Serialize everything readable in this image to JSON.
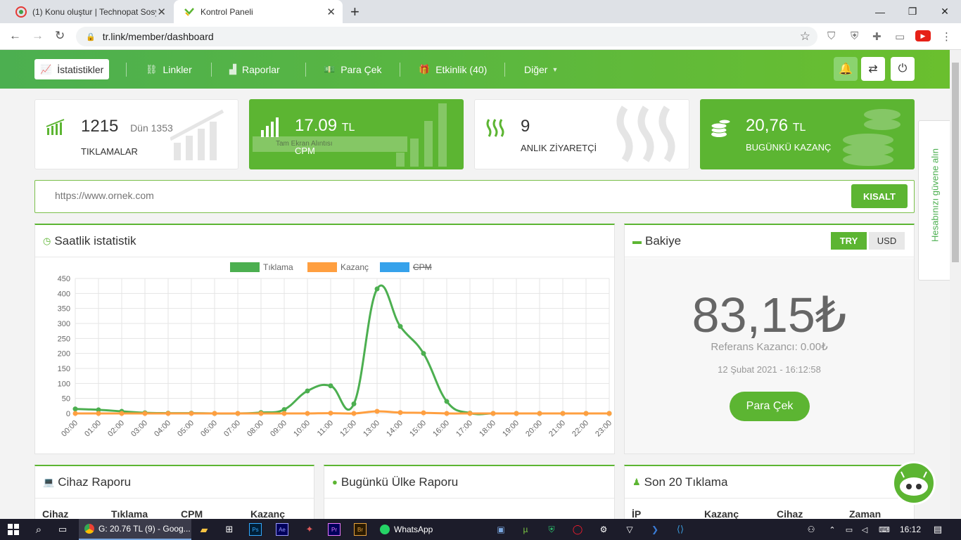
{
  "browser": {
    "tabs": [
      {
        "title": "(1) Konu oluştur | Technopat Sosyal",
        "active": false
      },
      {
        "title": "Kontrol Paneli",
        "active": true
      }
    ],
    "url": "tr.link/member/dashboard"
  },
  "nav": {
    "items": [
      {
        "label": "İstatistikler",
        "icon": "chart-line-icon"
      },
      {
        "label": "Linkler",
        "icon": "link-icon"
      },
      {
        "label": "Raporlar",
        "icon": "area-chart-icon"
      },
      {
        "label": "Para Çek",
        "icon": "money-icon"
      },
      {
        "label": "Etkinlik (40)",
        "icon": "gift-icon"
      },
      {
        "label": "Diğer",
        "icon": "chevron-down-icon"
      }
    ]
  },
  "stats": {
    "clicks": {
      "value": "1215",
      "yesterday": "Dün 1353",
      "label": "TIKLAMALAR"
    },
    "cpm": {
      "value": "17.09",
      "unit": "TL",
      "label": "CPM",
      "overlay": "Tam Ekran Alıntısı"
    },
    "visitors": {
      "value": "9",
      "label": "ANLIK ZİYARETÇİ"
    },
    "earnings": {
      "value": "20,76",
      "unit": "TL",
      "label": "BUGÜNKÜ KAZANÇ"
    }
  },
  "shortener": {
    "placeholder": "https://www.ornek.com",
    "button": "KISALT"
  },
  "hourly": {
    "title": "Saatlik istatistik"
  },
  "chart_data": {
    "type": "line",
    "categories": [
      "00:00",
      "01:00",
      "02:00",
      "03:00",
      "04:00",
      "05:00",
      "06:00",
      "07:00",
      "08:00",
      "09:00",
      "10:00",
      "11:00",
      "12:00",
      "13:00",
      "14:00",
      "15:00",
      "16:00",
      "17:00",
      "18:00",
      "19:00",
      "20:00",
      "21:00",
      "22:00",
      "23:00"
    ],
    "series": [
      {
        "name": "Tıklama",
        "color": "#4caf50",
        "values": [
          15,
          12,
          7,
          2,
          1,
          1,
          0,
          0,
          3,
          13,
          75,
          92,
          32,
          415,
          290,
          200,
          40,
          1,
          0,
          0,
          0,
          0,
          0,
          0
        ]
      },
      {
        "name": "Kazanç",
        "color": "#ff9f40",
        "values": [
          0,
          0,
          0,
          0,
          0,
          0,
          0,
          0,
          0,
          0,
          0,
          1,
          0,
          7,
          3,
          2,
          0,
          0,
          0,
          0,
          0,
          0,
          0,
          0
        ]
      },
      {
        "name": "CPM",
        "color": "#36a2eb",
        "values": [],
        "hidden": true
      }
    ],
    "yticks": [
      0,
      50,
      100,
      150,
      200,
      250,
      300,
      350,
      400,
      450
    ],
    "ylim": [
      0,
      450
    ]
  },
  "balance": {
    "title": "Bakiye",
    "currency_try": "TRY",
    "currency_usd": "USD",
    "amount": "83,15₺",
    "referral": "Referans Kazancı: 0.00₺",
    "date": "12 Şubat 2021 - 16:12:58",
    "withdraw": "Para Çek"
  },
  "device_report": {
    "title": "Cihaz Raporu",
    "columns": [
      "Cihaz",
      "Tıklama",
      "CPM",
      "Kazanç"
    ]
  },
  "country_report": {
    "title": "Bugünkü Ülke Raporu"
  },
  "last_clicks": {
    "title": "Son 20 Tıklama",
    "columns": [
      "İP",
      "Kazanç",
      "Cihaz",
      "Zaman"
    ]
  },
  "side_tab": "Hesabınızı güvene alın",
  "taskbar": {
    "chrome": "G: 20.76 TL (9) - Goog...",
    "whatsapp": "WhatsApp",
    "time": "16:12"
  }
}
